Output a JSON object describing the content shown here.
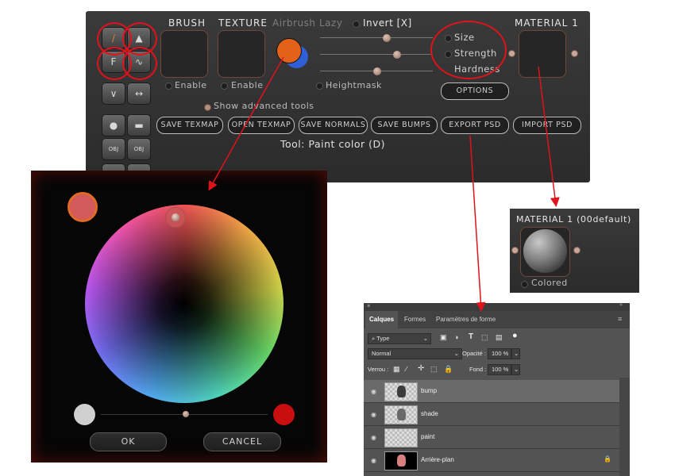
{
  "brush_panel": {
    "tabs": {
      "brush": "BRUSH",
      "texture": "TEXTURE",
      "airbrush": "Airbrush",
      "lazy": "Lazy",
      "invert": "Invert [X]"
    },
    "slider_labels": {
      "size": "Size",
      "strength": "Strength",
      "hardness": "Hardness"
    },
    "enable1": "Enable",
    "enable2": "Enable",
    "heightmask": "Heightmask",
    "options_button": "OPTIONS",
    "show_advanced": "Show advanced tools",
    "material_title": "MATERIAL 1",
    "buttons": [
      "SAVE TEXMAP",
      "OPEN TEXMAP",
      "SAVE NORMALS",
      "SAVE BUMPS",
      "EXPORT PSD",
      "IMPORT PSD"
    ],
    "tool_status": "Tool: Paint color (D)",
    "tool_icons": {
      "f_letter": "F",
      "obj1": "OBJ",
      "obj2": "OBJ"
    },
    "colors": {
      "primary": "#e2621a",
      "secondary": "#2f5fd6"
    }
  },
  "color_picker": {
    "ok": "OK",
    "cancel": "CANCEL",
    "current_color": "#d25a5a",
    "left_swatch": "#cfcfcf",
    "right_swatch": "#c80e0e"
  },
  "material_panel": {
    "title": "MATERIAL 1 (00default)",
    "colored": "Colored"
  },
  "layers_panel": {
    "tabs": [
      "Calques",
      "Formes",
      "Paramètres de forme"
    ],
    "filter": "⌕ Type",
    "blend_mode": "Normal",
    "opacity_label": "Opacité :",
    "opacity_value": "100 %",
    "lock_label": "Verrou :",
    "fill_label": "Fond :",
    "fill_value": "100 %",
    "layers": [
      {
        "name": "bump",
        "selected": true
      },
      {
        "name": "shade",
        "selected": false
      },
      {
        "name": "paint",
        "selected": false
      },
      {
        "name": "Arrière-plan",
        "selected": false
      }
    ]
  }
}
